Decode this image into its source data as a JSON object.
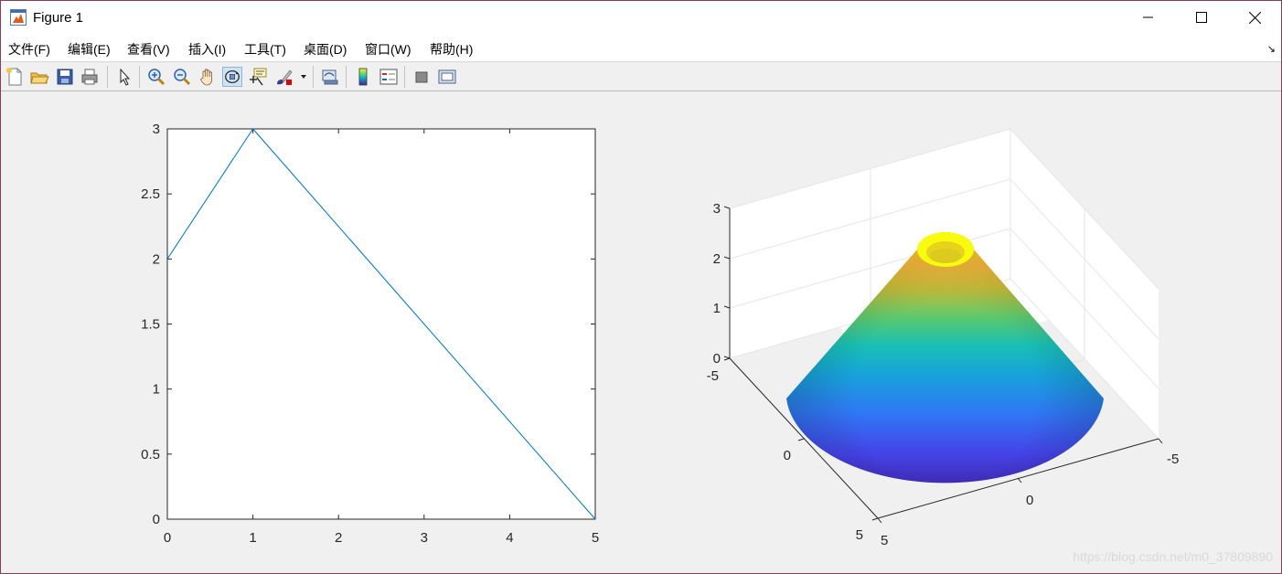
{
  "window": {
    "title": "Figure 1",
    "app_icon": "matlab-figure-icon"
  },
  "menu": [
    "文件(F)",
    "编辑(E)",
    "查看(V)",
    "插入(I)",
    "工具(T)",
    "桌面(D)",
    "窗口(W)",
    "帮助(H)"
  ],
  "toolbar": {
    "buttons": [
      "new-figure-icon",
      "open-file-icon",
      "save-icon",
      "print-icon",
      "select-arrow-icon",
      "zoom-in-icon",
      "zoom-out-icon",
      "pan-hand-icon",
      "rotate-3d-icon",
      "data-cursor-icon",
      "brush-icon",
      "link-plot-icon",
      "colorbar-icon",
      "legend-icon",
      "hide-plot-tools-icon",
      "show-plot-tools-icon"
    ],
    "active": "rotate-3d-icon"
  },
  "chart_data": [
    {
      "type": "line",
      "x": [
        0,
        1,
        5
      ],
      "y": [
        2,
        3,
        0
      ],
      "xlim": [
        0,
        5
      ],
      "ylim": [
        0,
        3
      ],
      "xticks": [
        "0",
        "1",
        "2",
        "3",
        "4",
        "5"
      ],
      "yticks": [
        "0",
        "0.5",
        "1",
        "1.5",
        "2",
        "2.5",
        "3"
      ],
      "line_color": "#0072bd",
      "grid": false
    },
    {
      "type": "surface",
      "surface_shape": "truncated cone",
      "r_outer": 5,
      "r_inner": 1,
      "z_at_outer": 0,
      "z_at_inner": 3,
      "colormap": "parula",
      "xlim": [
        -5,
        5
      ],
      "ylim": [
        -5,
        5
      ],
      "zlim": [
        0,
        3
      ],
      "xticks": [
        "-5",
        "0",
        "5"
      ],
      "yticks": [
        "-5",
        "0",
        "5"
      ],
      "zticks": [
        "0",
        "1",
        "2",
        "3"
      ],
      "grid": true
    }
  ],
  "watermark": "https://blog.csdn.net/m0_37809890"
}
